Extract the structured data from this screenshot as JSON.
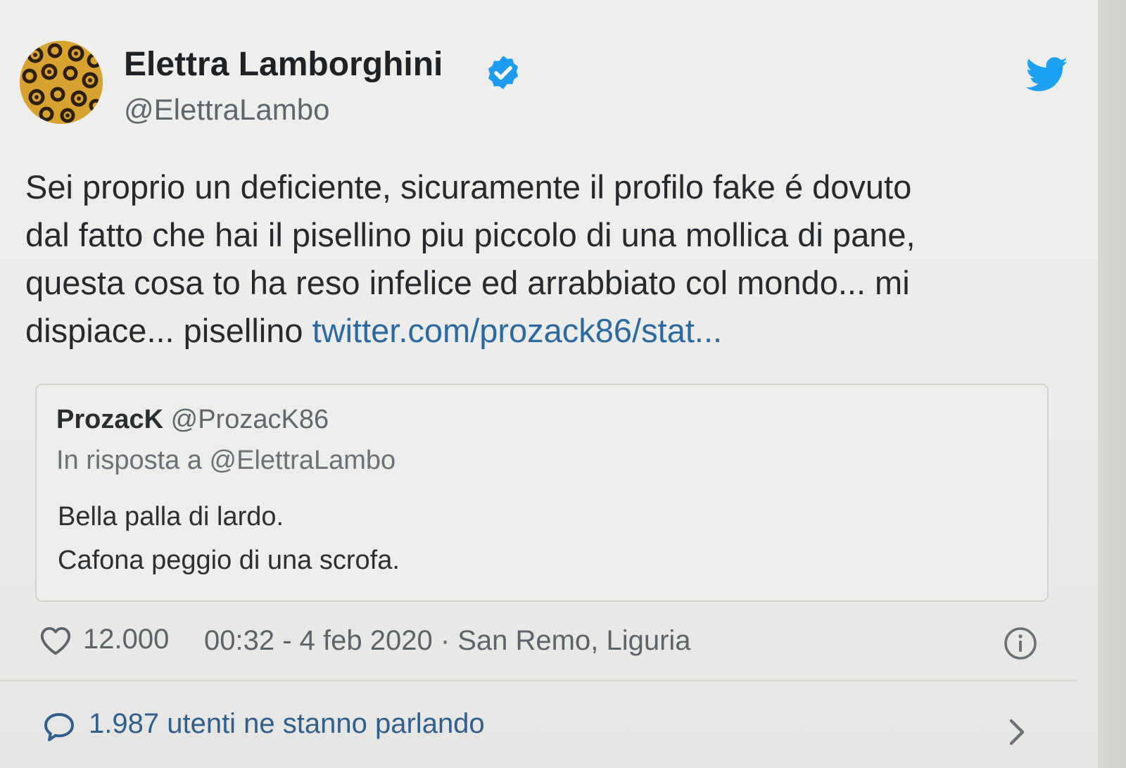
{
  "tweet": {
    "author": {
      "name": "Elettra Lamborghini",
      "handle": "@ElettraLambo",
      "verified": true,
      "avatar_icon": "leopard-print-avatar"
    },
    "text_lines": [
      "Sei proprio un deficiente, sicuramente il profilo fake é dovuto",
      "dal fatto che hai il pisellino piu piccolo di una mollica di pane,",
      "questa cosa to ha reso infelice ed arrabbiato col mondo... mi",
      "dispiace... pisellino "
    ],
    "link_text": "twitter.com/prozack86/stat...",
    "quote": {
      "name": "ProzacK",
      "handle": "@ProzacK86",
      "reply_to": "In risposta a @ElettraLambo",
      "lines": [
        "Bella palla di lardo.",
        "Cafona peggio di una scrofa."
      ]
    },
    "meta": {
      "likes": "12.000",
      "timestamp": "00:32 - 4 feb 2020 · San Remo, Liguria"
    },
    "conversation": {
      "text": "1.987 utenti ne stanno parlando"
    }
  },
  "colors": {
    "link": "#2b6aa1",
    "verified": "#1d9bf0",
    "twitter_bird": "#1da1f2",
    "background": "#ececea"
  },
  "icons": {
    "logo": "twitter-bird-icon",
    "verified": "verified-badge-icon",
    "like": "heart-icon",
    "info": "info-icon",
    "reply": "speech-bubble-icon",
    "navigate": "chevron-right-icon"
  }
}
